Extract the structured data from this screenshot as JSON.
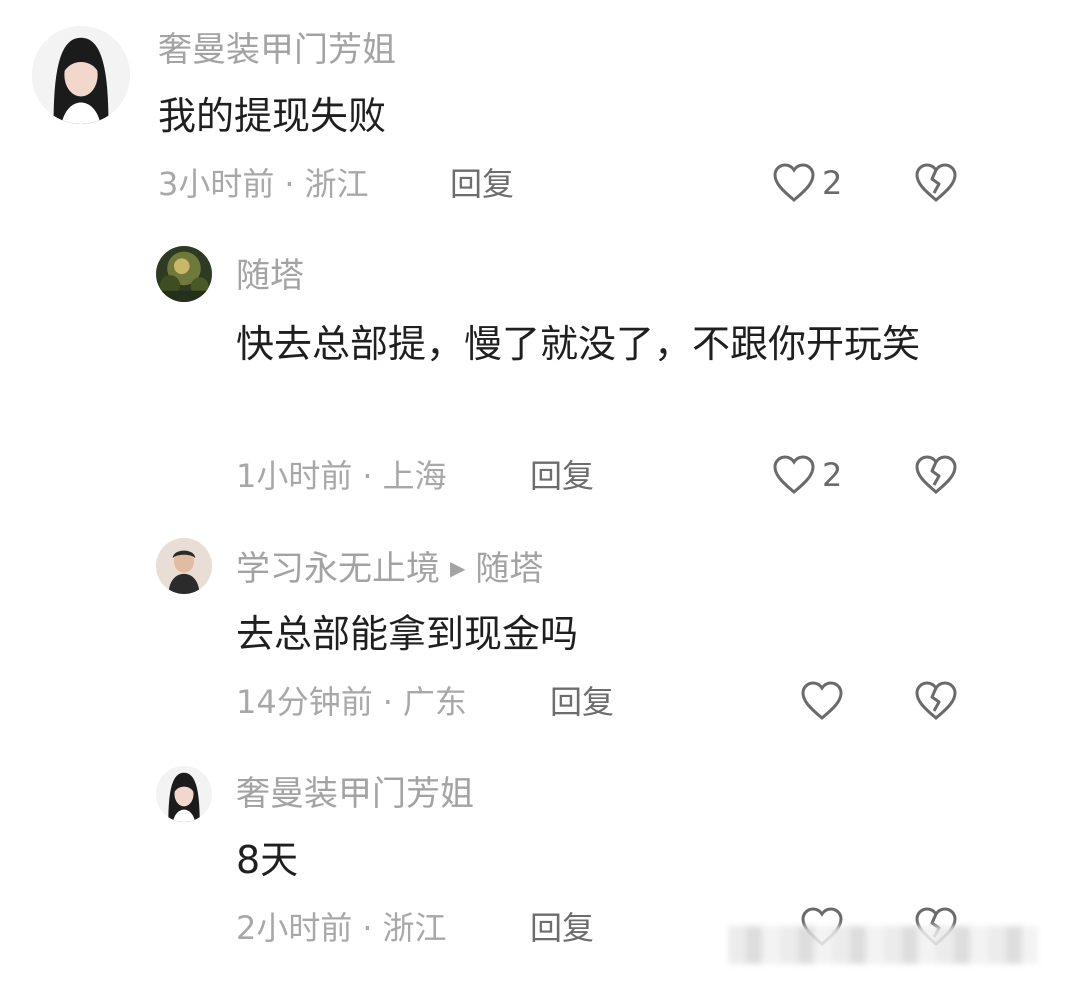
{
  "comments": [
    {
      "username": "奢曼装甲门芳姐",
      "text": "我的提现失败",
      "time": "3小时前",
      "location": "浙江",
      "reply_label": "回复",
      "likes": "2",
      "avatar": "woman-portrait-icon"
    },
    {
      "username": "随塔",
      "text": "快去总部提，慢了就没了，不跟你开玩笑",
      "time": "1小时前",
      "location": "上海",
      "reply_label": "回复",
      "likes": "2",
      "avatar": "forest-photo-icon"
    },
    {
      "username": "学习永无止境",
      "reply_to": "随塔",
      "text": "去总部能拿到现金吗",
      "time": "14分钟前",
      "location": "广东",
      "reply_label": "回复",
      "likes": "",
      "avatar": "man-photo-icon"
    },
    {
      "username": "奢曼装甲门芳姐",
      "text": "8天",
      "time": "2小时前",
      "location": "浙江",
      "reply_label": "回复",
      "likes": "",
      "avatar": "woman-portrait-icon"
    }
  ],
  "separator": "·",
  "colors": {
    "username": "#a3a3a3",
    "text": "#1f1f1f",
    "meta": "#a8a8a8",
    "icon": "#6a6a6a"
  }
}
